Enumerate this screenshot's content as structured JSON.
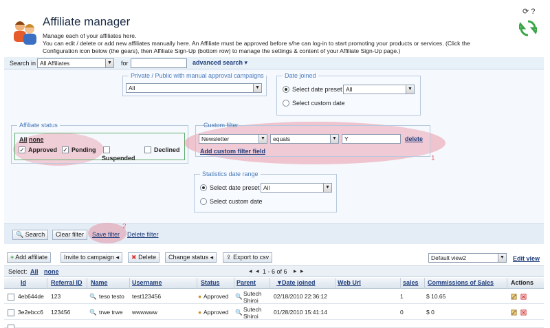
{
  "header": {
    "title": "Affiliate manager",
    "description_lines": [
      "Manage each of your affiliates here.",
      "You can edit / delete or add new affiliates manually here. An Affiliate must be approved before s/he can log-in to start promoting your products or services. (Click the",
      "Configuration icon below (the gears), then Affiliate Sign-Up (bottom row) to manage the settings & content of your Affiliate Sign-Up page.)"
    ]
  },
  "search": {
    "search_in_label": "Search in",
    "search_in_value": "All Affiliates",
    "for_label": "for",
    "for_value": "",
    "advanced_label": "advanced search"
  },
  "filters": {
    "campaigns": {
      "legend": "Private / Public with manual approval campaigns",
      "value": "All"
    },
    "date_joined": {
      "legend": "Date joined",
      "preset_label": "Select date preset",
      "preset_value": "All",
      "custom_label": "Select custom date"
    },
    "affiliate_status": {
      "legend": "Affiliate status",
      "all": "All",
      "none": "none",
      "approved": "Approved",
      "pending": "Pending",
      "suspended": "Suspended",
      "declined": "Declined"
    },
    "custom_filter": {
      "legend": "Custom filter",
      "field": "Newsletter",
      "operator": "equals",
      "value": "Y",
      "delete": "delete",
      "add": "Add custom filter field",
      "annotation": "1"
    },
    "stats_date_range": {
      "legend": "Statistics date range",
      "preset_label": "Select date preset",
      "preset_value": "All",
      "custom_label": "Select custom date"
    }
  },
  "filter_buttons": {
    "search": "Search",
    "clear": "Clear filter",
    "save": "Save filter",
    "delete": "Delete filter",
    "annotation": "2"
  },
  "toolbar": {
    "add": "Add affiliate",
    "invite": "Invite to campaign",
    "delete": "Delete",
    "change_status": "Change status",
    "export": "Export to csv",
    "view_value": "Default view2",
    "edit_view": "Edit view"
  },
  "selection": {
    "select_label": "Select:",
    "all": "All",
    "none": "none",
    "pager": "1 - 6 of 6"
  },
  "table": {
    "columns": [
      "Id",
      "Referral ID",
      "Name",
      "Username",
      "Status",
      "Parent",
      "Date joined",
      "Web Url",
      "sales",
      "Commissions of Sales",
      "Actions"
    ],
    "rows": [
      {
        "id": "4eb644de",
        "referral": "123",
        "name": "teso testo",
        "username": "test123456",
        "status": "Approved",
        "parent": "Sutech Shiroi",
        "date": "02/18/2010 22:36:12",
        "url": "",
        "sales": "1",
        "commission": "$ 10.65"
      },
      {
        "id": "3e2ebcc6",
        "referral": "123456",
        "name": "trwe trwe",
        "username": "wwwwww",
        "status": "Approved",
        "parent": "Sutech Shiroi",
        "date": "01/28/2010 15:41:14",
        "url": "",
        "sales": "0",
        "commission": "$ 0"
      }
    ]
  },
  "colors": {
    "accent": "#1e3d7b",
    "highlight": "#e66478",
    "panel": "#f5f8fc"
  }
}
